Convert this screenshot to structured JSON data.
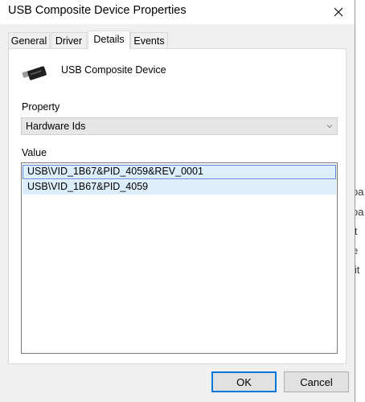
{
  "window": {
    "title": "USB Composite Device Properties"
  },
  "tabs": [
    {
      "label": "General",
      "active": false
    },
    {
      "label": "Driver",
      "active": false
    },
    {
      "label": "Details",
      "active": true
    },
    {
      "label": "Events",
      "active": false
    }
  ],
  "details": {
    "device_name": "USB Composite Device",
    "device_icon": "usb-connector-icon",
    "property_label": "Property",
    "property_selected": "Hardware Ids",
    "value_label": "Value",
    "values": [
      "USB\\VID_1B67&PID_4059&REV_0001",
      "USB\\VID_1B67&PID_4059"
    ]
  },
  "buttons": {
    "ok": "OK",
    "cancel": "Cancel"
  },
  "background_window": {
    "fragments": [
      "oa",
      "oa",
      "lt",
      "e",
      "lit"
    ]
  },
  "colors": {
    "accent": "#0078d7",
    "selection": "#dceefc"
  }
}
